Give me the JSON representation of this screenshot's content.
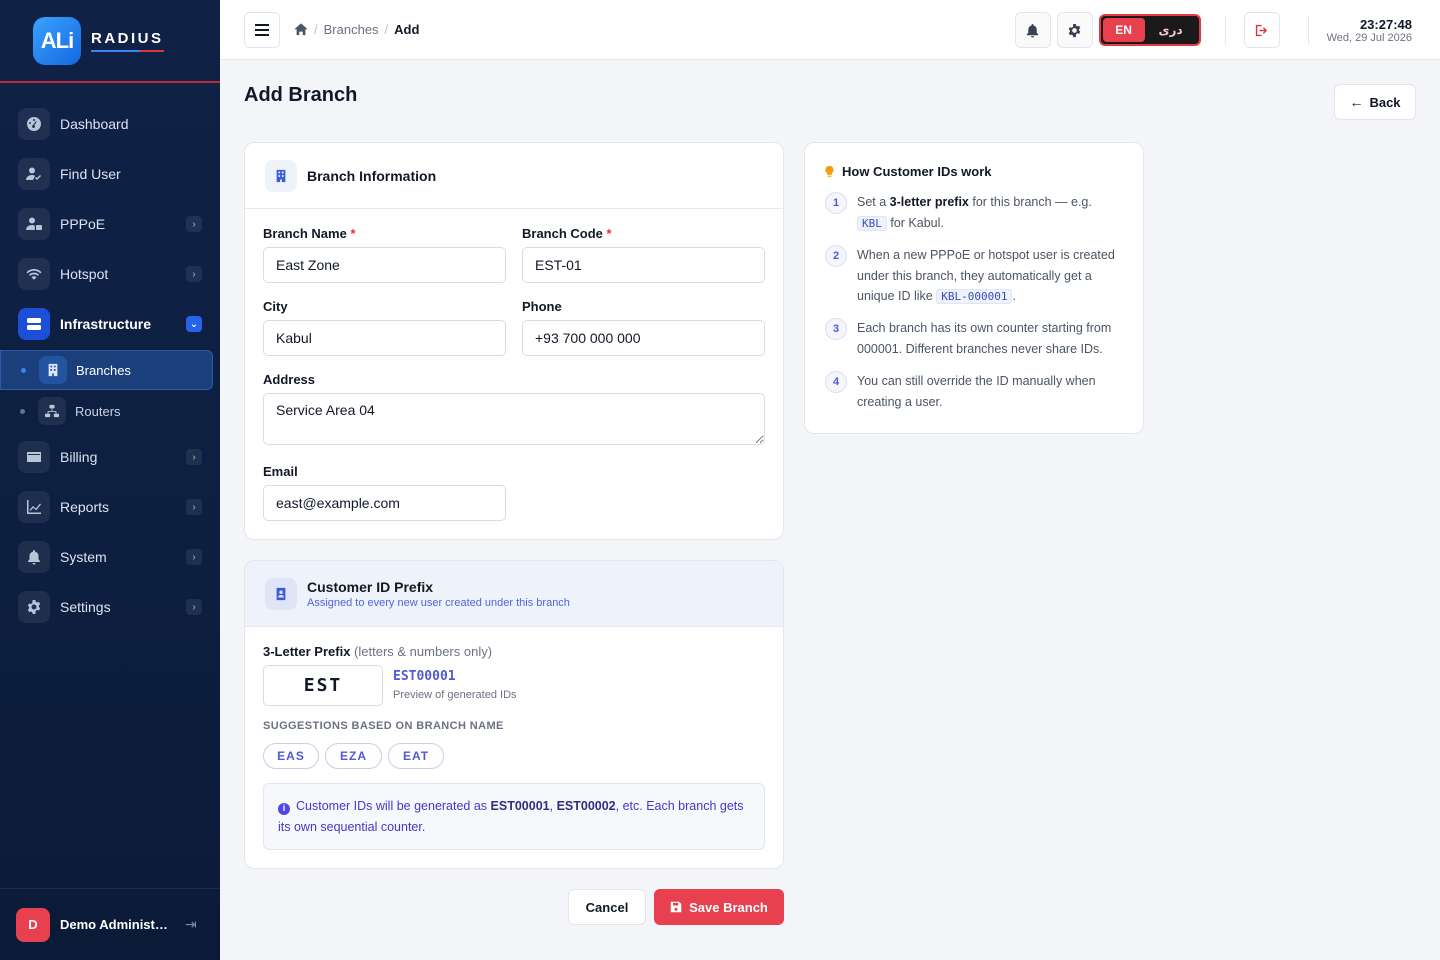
{
  "brand": {
    "logo_text": "ALi",
    "name": "RADIUS"
  },
  "sidebar": {
    "items": [
      {
        "label": "Dashboard",
        "icon": "dashboard-icon"
      },
      {
        "label": "Find User",
        "icon": "find-user-icon"
      },
      {
        "label": "PPPoE",
        "icon": "pppoe-icon"
      },
      {
        "label": "Hotspot",
        "icon": "wifi-icon"
      },
      {
        "label": "Infrastructure",
        "icon": "server-icon"
      },
      {
        "label": "Billing",
        "icon": "billing-icon"
      },
      {
        "label": "Reports",
        "icon": "chart-icon"
      },
      {
        "label": "System",
        "icon": "bell-icon"
      },
      {
        "label": "Settings",
        "icon": "gear-icon"
      }
    ],
    "sub_items": [
      {
        "label": "Branches",
        "icon": "building-icon",
        "active": true
      },
      {
        "label": "Routers",
        "icon": "network-icon",
        "active": false
      }
    ],
    "user": {
      "initial": "D",
      "name": "Demo Administrator"
    }
  },
  "topbar": {
    "breadcrumb": [
      "Branches",
      "Add"
    ],
    "lang": {
      "en": "EN",
      "dari": "دری"
    },
    "clock": {
      "time": "23:27:48",
      "date": "Wed, 29 Jul 2026"
    }
  },
  "page": {
    "title": "Add Branch",
    "back_label": "Back"
  },
  "branch_info": {
    "title": "Branch Information",
    "fields": {
      "name": {
        "label": "Branch Name",
        "value": "East Zone"
      },
      "code": {
        "label": "Branch Code",
        "value": "EST-01"
      },
      "city": {
        "label": "City",
        "value": "Kabul"
      },
      "phone": {
        "label": "Phone",
        "value": "+93 700 000 000"
      },
      "address": {
        "label": "Address",
        "value": "Service Area 04"
      },
      "email": {
        "label": "Email",
        "value": "east@example.com"
      }
    },
    "required_mark": "*"
  },
  "prefix": {
    "title": "Customer ID Prefix",
    "subtitle": "Assigned to every new user created under this branch",
    "label": "3-Letter Prefix",
    "label_hint": "(letters & numbers only)",
    "value": "EST",
    "preview_id": "EST00001",
    "preview_caption": "Preview of generated IDs",
    "suggestions_title": "SUGGESTIONS BASED ON BRANCH NAME",
    "suggestions": [
      "EAS",
      "EZA",
      "EAT"
    ],
    "info": {
      "prefix": "Customer IDs will be generated as ",
      "id1": "EST00001",
      "comma": ", ",
      "id2": "EST00002",
      "suffix": ", etc. Each branch gets its own sequential counter."
    }
  },
  "actions": {
    "cancel": "Cancel",
    "save": "Save Branch"
  },
  "help": {
    "title": "How Customer IDs work",
    "steps": [
      {
        "num": "1",
        "a": "Set a ",
        "b": "3-letter prefix",
        "c": " for this branch — e.g. ",
        "code": "KBL",
        "d": " for Kabul."
      },
      {
        "num": "2",
        "a": "When a new PPPoE or hotspot user is created under this branch, they automatically get a unique ID like ",
        "code": "KBL-000001",
        "d": "."
      },
      {
        "num": "3",
        "a": "Each branch has its own counter starting from 000001. Different branches never share IDs."
      },
      {
        "num": "4",
        "a": "You can still override the ID manually when creating a user."
      }
    ]
  },
  "colors": {
    "accent": "#e8404e",
    "sidebar": "#0f2246",
    "primary": "#1d4ed8"
  }
}
